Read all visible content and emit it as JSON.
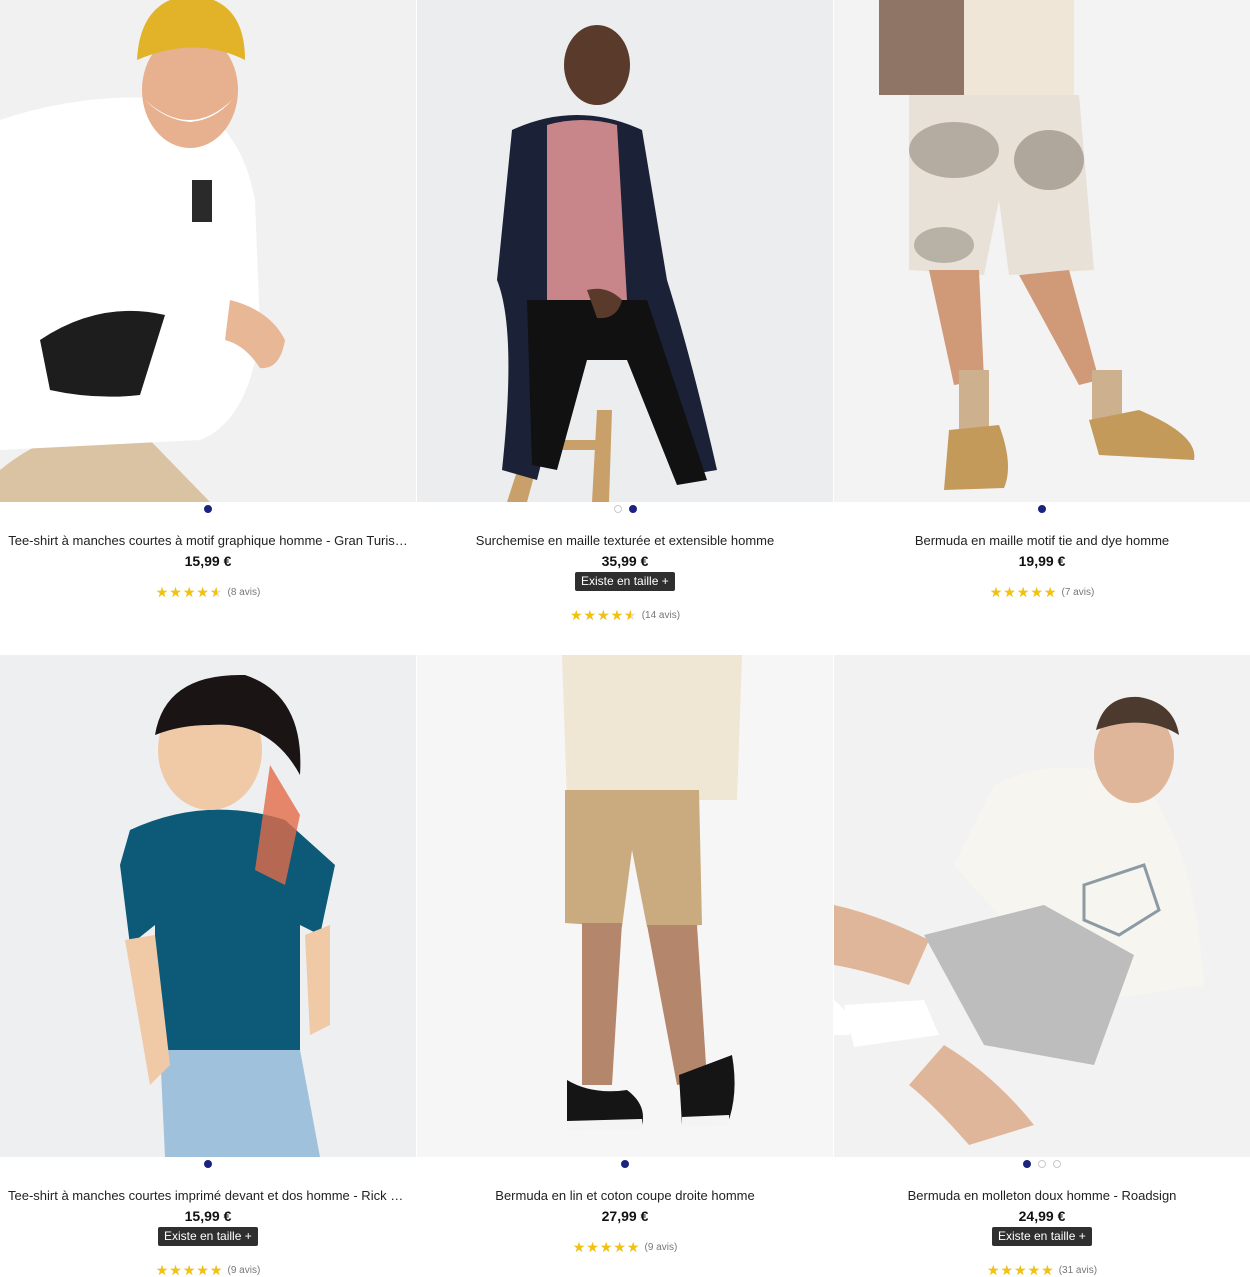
{
  "colors": {
    "star": "#f2c20e",
    "dot_active": "#1a237e",
    "badge_bg": "#2f2f2f"
  },
  "products": [
    {
      "title": "Tee-shirt à manches courtes à motif graphique homme - Gran Turis…",
      "price": "15,99 €",
      "size_badge": null,
      "rating": 4.5,
      "reviews": "(8 avis)",
      "photo_dots": 1,
      "active_dot": 0,
      "photo_icon": "model-white-tshirt-yellow-beanie"
    },
    {
      "title": "Surchemise en maille texturée et extensible homme",
      "price": "35,99 €",
      "size_badge": "Existe en taille +",
      "rating": 4.5,
      "reviews": "(14 avis)",
      "photo_dots": 2,
      "active_dot": 1,
      "photo_icon": "model-navy-overshirt-stool"
    },
    {
      "title": "Bermuda en maille motif tie and dye homme",
      "price": "19,99 €",
      "size_badge": null,
      "rating": 5,
      "reviews": "(7 avis)",
      "photo_dots": 1,
      "active_dot": 0,
      "photo_icon": "model-tie-dye-shorts"
    },
    {
      "title": "Tee-shirt à manches courtes imprimé devant et dos homme - Rick &…",
      "price": "15,99 €",
      "size_badge": "Existe en taille +",
      "rating": 5,
      "reviews": "(9 avis)",
      "photo_dots": 1,
      "active_dot": 0,
      "photo_icon": "model-teal-tshirt-jeans"
    },
    {
      "title": "Bermuda en lin et coton coupe droite homme",
      "price": "27,99 €",
      "size_badge": null,
      "rating": 5,
      "reviews": "(9 avis)",
      "photo_dots": 1,
      "active_dot": 0,
      "photo_icon": "model-beige-linen-shorts"
    },
    {
      "title": "Bermuda en molleton doux homme - Roadsign",
      "price": "24,99 €",
      "size_badge": "Existe en taille +",
      "rating": 5,
      "reviews": "(31 avis)",
      "photo_dots": 3,
      "active_dot": 0,
      "photo_icon": "model-white-hoodie-grey-shorts"
    }
  ]
}
